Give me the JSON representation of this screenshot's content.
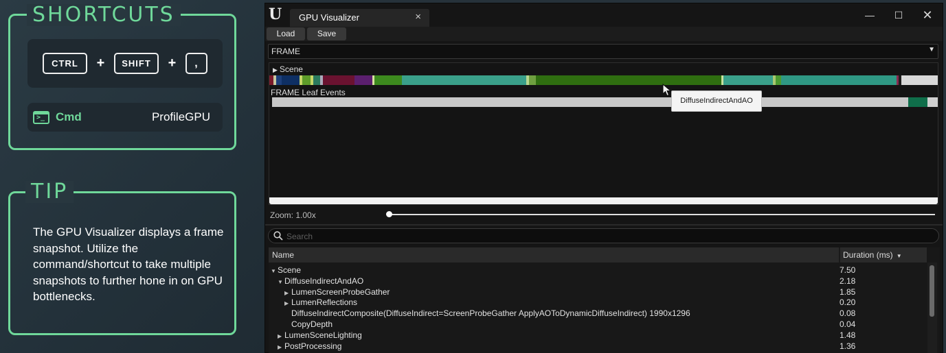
{
  "shortcuts": {
    "title": "SHORTCUTS",
    "keys": [
      "CTRL",
      "SHIFT",
      ","
    ],
    "plus": "+",
    "cmd_label": "Cmd",
    "cmd_value": "ProfileGPU"
  },
  "tip": {
    "title": "TIP",
    "text": "The GPU Visualizer displays a frame snapshot. Utilize the command/shortcut to take multiple snapshots to further hone in on GPU bottlenecks."
  },
  "window": {
    "logo": "U",
    "tab_label": "GPU Visualizer",
    "tab_close": "×",
    "minimize": "—",
    "maximize": "☐",
    "close": "✕"
  },
  "toolbar": {
    "load_label": "Load",
    "save_label": "Save"
  },
  "frame_select": {
    "value": "FRAME"
  },
  "timeline": {
    "scene_label": "Scene",
    "leaf_label": "FRAME Leaf Events",
    "tooltip": "DiffuseIndirectAndAO"
  },
  "zoom": {
    "label": "Zoom: 1.00x",
    "value": 1.0
  },
  "search": {
    "placeholder": "Search"
  },
  "tree": {
    "col_name": "Name",
    "col_duration": "Duration (ms)",
    "rows": [
      {
        "name": "Scene",
        "duration": "7.50",
        "arrow": "▼"
      },
      {
        "name": "DiffuseIndirectAndAO",
        "duration": "2.18",
        "arrow": "▼"
      },
      {
        "name": "LumenScreenProbeGather",
        "duration": "1.85",
        "arrow": "▶"
      },
      {
        "name": "LumenReflections",
        "duration": "0.20",
        "arrow": "▶"
      },
      {
        "name": "DiffuseIndirectComposite(DiffuseIndirect=ScreenProbeGather ApplyAOToDynamicDiffuseIndirect) 1990x1296",
        "duration": "0.08",
        "arrow": ""
      },
      {
        "name": "CopyDepth",
        "duration": "0.04",
        "arrow": ""
      },
      {
        "name": "LumenSceneLighting",
        "duration": "1.48",
        "arrow": "▶"
      },
      {
        "name": "PostProcessing",
        "duration": "1.36",
        "arrow": "▶"
      }
    ]
  }
}
